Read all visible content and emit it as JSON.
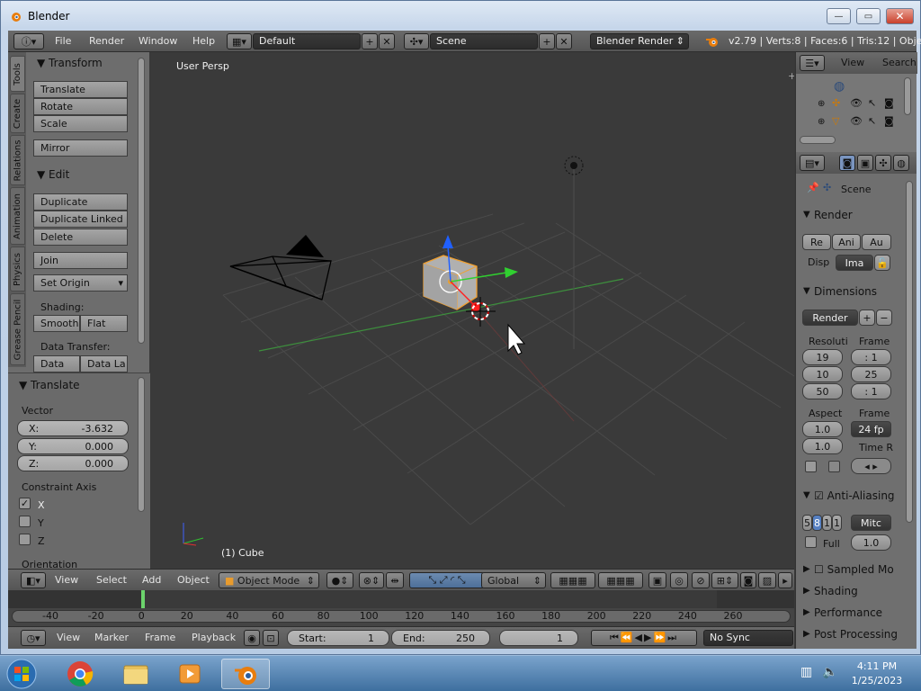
{
  "window": {
    "title": "Blender"
  },
  "header": {
    "menus": [
      "File",
      "Render",
      "Window",
      "Help"
    ],
    "layout": "Default",
    "scene": "Scene",
    "engine": "Blender Render",
    "stats": "v2.79 | Verts:8 | Faces:6 | Tris:12 | Objects"
  },
  "tool_tabs": [
    "Tools",
    "Create",
    "Relations",
    "Animation",
    "Physics",
    "Grease Pencil"
  ],
  "tools": {
    "transform_title": "Transform",
    "translate": "Translate",
    "rotate": "Rotate",
    "scale": "Scale",
    "mirror": "Mirror",
    "edit_title": "Edit",
    "duplicate": "Duplicate",
    "duplicate_linked": "Duplicate Linked",
    "delete": "Delete",
    "join": "Join",
    "set_origin": "Set Origin",
    "shading_label": "Shading:",
    "smooth": "Smooth",
    "flat": "Flat",
    "data_transfer_label": "Data Transfer:",
    "data": "Data",
    "data_la": "Data La"
  },
  "operator": {
    "title": "Translate",
    "vector_label": "Vector",
    "x_label": "X:",
    "x": "-3.632",
    "y_label": "Y:",
    "y": "0.000",
    "z_label": "Z:",
    "z": "0.000",
    "constraint_label": "Constraint Axis",
    "axis_x": "X",
    "axis_y": "Y",
    "axis_z": "Z",
    "axis_x_checked": true,
    "orientation": "Orientation"
  },
  "viewport": {
    "view_name": "User Persp",
    "object_name": "(1) Cube"
  },
  "viewport_header": {
    "menus": [
      "View",
      "Select",
      "Add",
      "Object"
    ],
    "mode": "Object Mode",
    "orientation": "Global"
  },
  "timeline": {
    "ticks": [
      "-40",
      "-20",
      "0",
      "20",
      "40",
      "60",
      "80",
      "100",
      "120",
      "140",
      "160",
      "180",
      "200",
      "220",
      "240",
      "260"
    ],
    "current_frame": 0
  },
  "timeline_header": {
    "menus": [
      "View",
      "Marker",
      "Frame",
      "Playback"
    ],
    "start_label": "Start:",
    "start": "1",
    "end_label": "End:",
    "end": "250",
    "current": "1",
    "sync": "No Sync"
  },
  "outliner": {
    "view": "View",
    "search": "Search"
  },
  "properties": {
    "scene": "Scene",
    "render_title": "Render",
    "render_btns": [
      "Re",
      "Ani",
      "Au"
    ],
    "disp_label": "Disp",
    "disp_value": "Ima",
    "dimensions_title": "Dimensions",
    "preset": "Render",
    "resolution_label": "Resoluti",
    "frame_label": "Frame",
    "res_x": "19",
    "res_y": "10",
    "res_pct": "50",
    "frame_start": ": 1",
    "frame_end": "25",
    "frame_step": ": 1",
    "aspect_label": "Aspect",
    "frame_rate_label": "Frame",
    "aspect_x": "1.0",
    "aspect_y": "1.0",
    "fps": "24 fp",
    "time_label": "Time R",
    "aa_title": "Anti-Aliasing",
    "aa_samples": [
      "5",
      "8",
      "1",
      "1"
    ],
    "aa_filter": "Mitc",
    "full_label": "Full",
    "full_value": "1.0",
    "sampled_title": "Sampled Mo",
    "shading_title": "Shading",
    "performance_title": "Performance",
    "post_title": "Post Processing"
  },
  "taskbar": {
    "time": "4:11 PM",
    "date": "1/25/2023"
  }
}
